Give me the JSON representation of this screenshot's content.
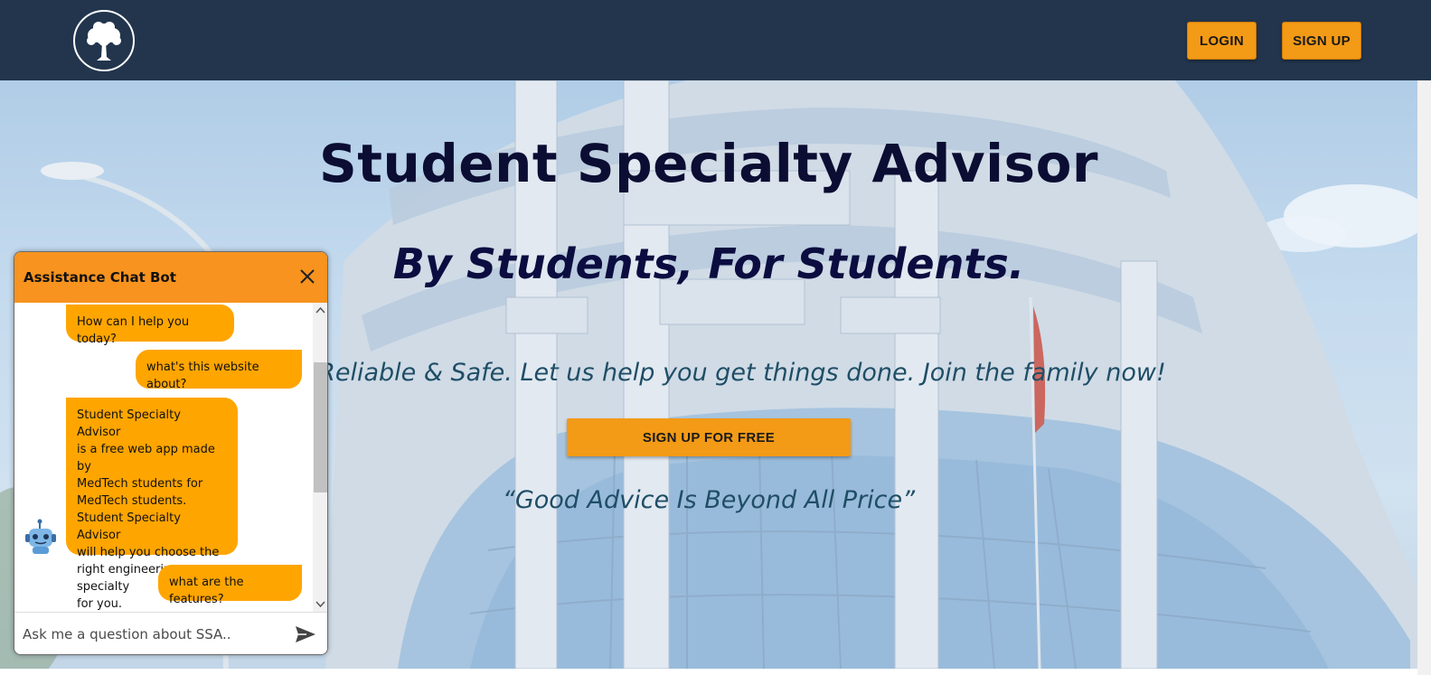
{
  "navbar": {
    "logo_icon": "tree-logo-icon",
    "login_label": "LOGIN",
    "signup_label": "SIGN UP",
    "background_color": "#22354d",
    "button_color": "#f39a16"
  },
  "hero": {
    "title": "Student Specialty Advisor",
    "subtitle": "By Students, For Students.",
    "tagline": "Fast, Reliable & Safe. Let us help you get things done. Join the family now!",
    "cta_label": "SIGN UP FOR FREE",
    "quote": "“Good Advice Is Beyond All Price”",
    "background_image": "modern-glass-building-photo"
  },
  "chat": {
    "title": "Assistance Chat Bot",
    "close_icon": "close-icon",
    "bot_avatar_icon": "robot-icon",
    "send_icon": "send-icon",
    "header_color": "#f7931e",
    "bubble_color": "#ffa500",
    "messages": [
      {
        "from": "bot",
        "text": "How can I help you today?"
      },
      {
        "from": "user",
        "text": "what's this website about?"
      },
      {
        "from": "bot",
        "text": "Student Specialty Advisor\nis a free web app made by\nMedTech students for\nMedTech students.\nStudent Specialty Advisor\nwill help you choose the\nright engineering specialty\nfor you."
      },
      {
        "from": "user",
        "text": "what are the features?"
      }
    ],
    "input_placeholder": "Ask me a question about SSA.."
  }
}
